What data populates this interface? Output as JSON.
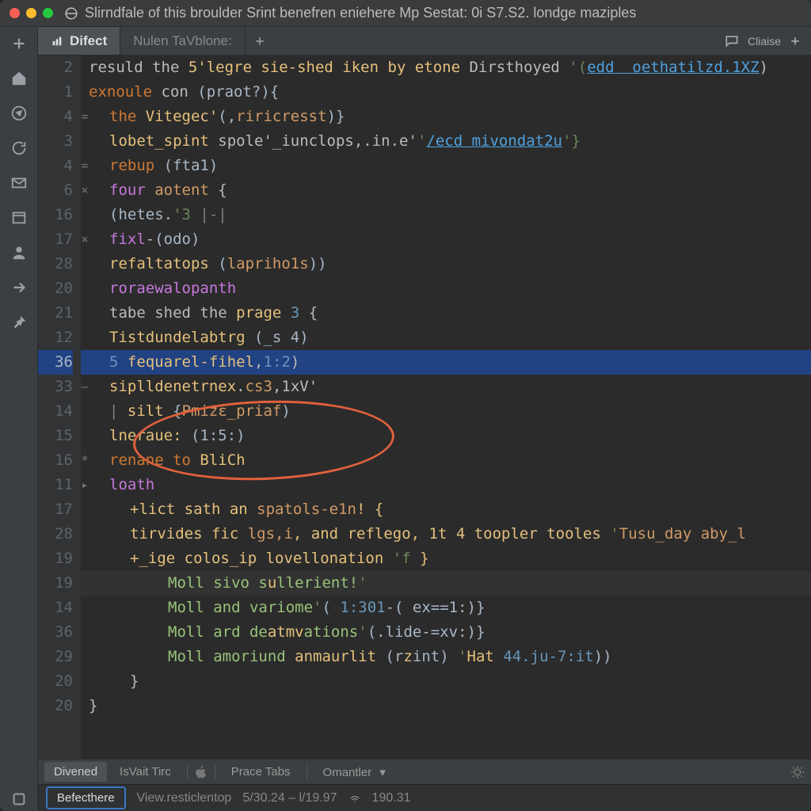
{
  "window": {
    "title": "Slirndfale of this broulder Srint benefren eniehere Mp Sestat: 0i S7.S2. londge maziples"
  },
  "tabs": {
    "items": [
      {
        "label": "Difect",
        "active": true,
        "icon": "chart"
      },
      {
        "label": "Nulen TaVblone:",
        "active": false
      }
    ],
    "right_label": "Cliaise"
  },
  "editor": {
    "lines": [
      {
        "num": "2",
        "marker": "",
        "sel": false,
        "indent": 0,
        "tokens": [
          {
            "c": "pl",
            "t": "resuld the "
          },
          {
            "c": "fn",
            "t": "5'legre sie-shed iken by etone "
          },
          {
            "c": "pl",
            "t": "Dirsthoyed "
          },
          {
            "c": "str",
            "t": "'("
          },
          {
            "c": "link",
            "t": "edd  oethatilzd.1XZ"
          },
          {
            "c": "pl",
            "t": ")"
          }
        ]
      },
      {
        "num": "1",
        "marker": "",
        "sel": false,
        "indent": 0,
        "tokens": [
          {
            "c": "kw",
            "t": "exnoule "
          },
          {
            "c": "pl",
            "t": "con "
          },
          {
            "c": "par",
            "t": "(praot?){"
          }
        ]
      },
      {
        "num": "4",
        "marker": "=",
        "sel": false,
        "indent": 1,
        "tokens": [
          {
            "c": "kw",
            "t": "the "
          },
          {
            "c": "fn",
            "t": "Vitegec'"
          },
          {
            "c": "par",
            "t": "(,"
          },
          {
            "c": "hl",
            "t": "riricresst"
          },
          {
            "c": "par",
            "t": ")} "
          }
        ]
      },
      {
        "num": "3",
        "marker": "",
        "sel": false,
        "indent": 1,
        "tokens": [
          {
            "c": "fn",
            "t": "lobet_spint "
          },
          {
            "c": "pl",
            "t": "spole'_iunclops,.in.e'"
          },
          {
            "c": "str",
            "t": "'"
          },
          {
            "c": "link",
            "t": "/ecd mivondat2u"
          },
          {
            "c": "str",
            "t": "'}"
          }
        ]
      },
      {
        "num": "4",
        "marker": "=",
        "sel": false,
        "indent": 1,
        "tokens": [
          {
            "c": "kw",
            "t": "rebup "
          },
          {
            "c": "par",
            "t": "(fta1)"
          }
        ]
      },
      {
        "num": "6",
        "marker": "×",
        "sel": false,
        "indent": 1,
        "tokens": [
          {
            "c": "kw2",
            "t": "four "
          },
          {
            "c": "hl",
            "t": "aotent "
          },
          {
            "c": "pl",
            "t": "{"
          }
        ]
      },
      {
        "num": "16",
        "marker": "",
        "sel": false,
        "indent": 1,
        "tokens": [
          {
            "c": "par",
            "t": "(hetes."
          },
          {
            "c": "str",
            "t": "'3 "
          },
          {
            "c": "com",
            "t": "|-| "
          }
        ]
      },
      {
        "num": "17",
        "marker": "×",
        "sel": false,
        "indent": 1,
        "tokens": [
          {
            "c": "kw2",
            "t": "fixl"
          },
          {
            "c": "pl",
            "t": "-"
          },
          {
            "c": "par",
            "t": "(odo)"
          }
        ]
      },
      {
        "num": "28",
        "marker": "",
        "sel": false,
        "indent": 1,
        "tokens": [
          {
            "c": "fn",
            "t": "refaltatops "
          },
          {
            "c": "par",
            "t": "("
          },
          {
            "c": "hl",
            "t": "lapriho1s"
          },
          {
            "c": "par",
            "t": "))"
          }
        ]
      },
      {
        "num": "20",
        "marker": "",
        "sel": false,
        "indent": 1,
        "tokens": [
          {
            "c": "kw2",
            "t": "roraewalopanth"
          }
        ]
      },
      {
        "num": "21",
        "marker": "",
        "sel": false,
        "indent": 1,
        "tokens": [
          {
            "c": "pl",
            "t": "tabe shed the "
          },
          {
            "c": "fn",
            "t": "prage "
          },
          {
            "c": "num",
            "t": "3 "
          },
          {
            "c": "pl",
            "t": "{"
          }
        ]
      },
      {
        "num": "12",
        "marker": "",
        "sel": false,
        "indent": 1,
        "tokens": [
          {
            "c": "fn",
            "t": "Tistdundelabtrg "
          },
          {
            "c": "par",
            "t": "(_s 4)"
          }
        ]
      },
      {
        "num": "36",
        "marker": "",
        "sel": true,
        "indent": 1,
        "tokens": [
          {
            "c": "num",
            "t": "5 "
          },
          {
            "c": "fn",
            "t": "fequarel-fihel"
          },
          {
            "c": "pl",
            "t": ","
          },
          {
            "c": "num",
            "t": "1:2"
          },
          {
            "c": "pl",
            "t": ")"
          }
        ]
      },
      {
        "num": "33",
        "marker": "–",
        "sel": false,
        "indent": 1,
        "tokens": [
          {
            "c": "fn",
            "t": "siplldenetrnex"
          },
          {
            "c": "pl",
            "t": "."
          },
          {
            "c": "hl",
            "t": "cs3"
          },
          {
            "c": "pl",
            "t": ",1xV'"
          }
        ]
      },
      {
        "num": "14",
        "marker": "",
        "sel": false,
        "indent": 1,
        "tokens": [
          {
            "c": "com",
            "t": "| "
          },
          {
            "c": "fn",
            "t": "silt "
          },
          {
            "c": "par",
            "t": "{"
          },
          {
            "c": "hl",
            "t": "Pmizε_priaf"
          },
          {
            "c": "par",
            "t": ")"
          }
        ]
      },
      {
        "num": "15",
        "marker": "",
        "sel": false,
        "indent": 1,
        "tokens": [
          {
            "c": "fn",
            "t": "lneraue: "
          },
          {
            "c": "par",
            "t": "(1:5:)"
          }
        ]
      },
      {
        "num": "16",
        "marker": "*",
        "sel": false,
        "indent": 1,
        "tokens": [
          {
            "c": "kw",
            "t": "renane to "
          },
          {
            "c": "fn",
            "t": "BliCh"
          }
        ]
      },
      {
        "num": "11",
        "marker": "▸",
        "sel": false,
        "indent": 1,
        "tokens": [
          {
            "c": "kw2",
            "t": "loath"
          }
        ]
      },
      {
        "num": "17",
        "marker": "",
        "sel": false,
        "indent": 2,
        "tokens": [
          {
            "c": "yel",
            "t": "+lict sath an "
          },
          {
            "c": "hl",
            "t": "spatols-e1n"
          },
          {
            "c": "yel",
            "t": "! {"
          }
        ]
      },
      {
        "num": "28",
        "marker": "",
        "sel": false,
        "indent": 2,
        "tokens": [
          {
            "c": "yel",
            "t": "tirvides fic "
          },
          {
            "c": "hl",
            "t": "lgs,i"
          },
          {
            "c": "yel",
            "t": ", and "
          },
          {
            "c": "fn",
            "t": "reflego"
          },
          {
            "c": "yel",
            "t": ", 1t 4 toopler tooles "
          },
          {
            "c": "str",
            "t": "'"
          },
          {
            "c": "hl",
            "t": "Tusu_day aby_l"
          }
        ]
      },
      {
        "num": "19",
        "marker": "",
        "sel": false,
        "indent": 2,
        "tokens": [
          {
            "c": "yel",
            "t": "+_ige colos_ip "
          },
          {
            "c": "fn",
            "t": "lovellonation "
          },
          {
            "c": "str",
            "t": "'f "
          },
          {
            "c": "yel",
            "t": "}"
          }
        ]
      },
      {
        "num": "19",
        "marker": "",
        "sel": false,
        "dim": true,
        "indent": 3,
        "tokens": [
          {
            "c": "grn",
            "t": "Moll sivo s"
          },
          {
            "c": "fn",
            "t": "u"
          },
          {
            "c": "grn",
            "t": "llerient!"
          },
          {
            "c": "str",
            "t": "'"
          }
        ]
      },
      {
        "num": "14",
        "marker": "",
        "sel": false,
        "indent": 3,
        "tokens": [
          {
            "c": "grn",
            "t": "Moll and variome"
          },
          {
            "c": "str",
            "t": "'"
          },
          {
            "c": "par",
            "t": "( "
          },
          {
            "c": "num",
            "t": "1:301"
          },
          {
            "c": "par",
            "t": "-( ex==1:)}"
          }
        ]
      },
      {
        "num": "36",
        "marker": "",
        "sel": false,
        "indent": 3,
        "tokens": [
          {
            "c": "grn",
            "t": "Moll ard de"
          },
          {
            "c": "fn",
            "t": "atmv"
          },
          {
            "c": "grn",
            "t": "ations"
          },
          {
            "c": "str",
            "t": "'"
          },
          {
            "c": "par",
            "t": "(.lide-=xv:)}"
          }
        ]
      },
      {
        "num": "29",
        "marker": "",
        "sel": false,
        "indent": 3,
        "tokens": [
          {
            "c": "grn",
            "t": "Moll amoriund "
          },
          {
            "c": "fn",
            "t": "anmaurlit "
          },
          {
            "c": "par",
            "t": "(r"
          },
          {
            "c": "fn",
            "t": "z"
          },
          {
            "c": "par",
            "t": "int) "
          },
          {
            "c": "str",
            "t": "'"
          },
          {
            "c": "fn",
            "t": "Hat "
          },
          {
            "c": "num",
            "t": "44.ju-7:it"
          },
          {
            "c": "par",
            "t": "))"
          }
        ]
      },
      {
        "num": "20",
        "marker": "",
        "sel": false,
        "indent": 2,
        "tokens": [
          {
            "c": "pl",
            "t": "}"
          }
        ]
      },
      {
        "num": "20",
        "marker": "",
        "sel": false,
        "indent": 0,
        "tokens": [
          {
            "c": "pl",
            "t": "}"
          }
        ]
      }
    ]
  },
  "bottombar": {
    "tabs": [
      "Divened",
      "IsVait Tirc"
    ],
    "mid": [
      "Prace Tabs",
      "Omantler"
    ]
  },
  "statusbar": {
    "button": "Befecthere",
    "items": [
      "View.resticlentop",
      "5/30.24 – l/19.97",
      "190.31"
    ]
  }
}
